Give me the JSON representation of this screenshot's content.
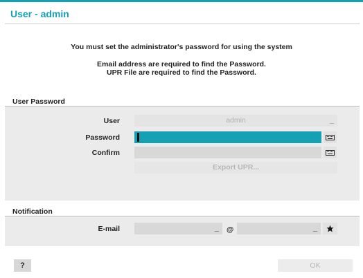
{
  "window": {
    "title": "User - admin"
  },
  "messages": {
    "line1": "You must set the administrator's password for using the system",
    "line2": "Email address are required to find the Password.",
    "line3": "UPR File are required to find the Password."
  },
  "user_password": {
    "section_label": "User Password",
    "user_label": "User",
    "user_value": "admin",
    "user_suffix": "_",
    "password_label": "Password",
    "confirm_label": "Confirm",
    "export_label": "Export UPR..."
  },
  "notification": {
    "section_label": "Notification",
    "email_label": "E-mail",
    "email_local_suffix": "_",
    "at_sign": "@",
    "email_domain_suffix": "_"
  },
  "footer": {
    "help_label": "?",
    "ok_label": "OK"
  },
  "colors": {
    "accent": "#16a0b3",
    "panel": "#ebebeb",
    "field": "#d8d8d8",
    "disabled_text": "#b6b6b6"
  },
  "icons": {
    "keyboard": "keyboard-icon",
    "star": "star-icon"
  }
}
